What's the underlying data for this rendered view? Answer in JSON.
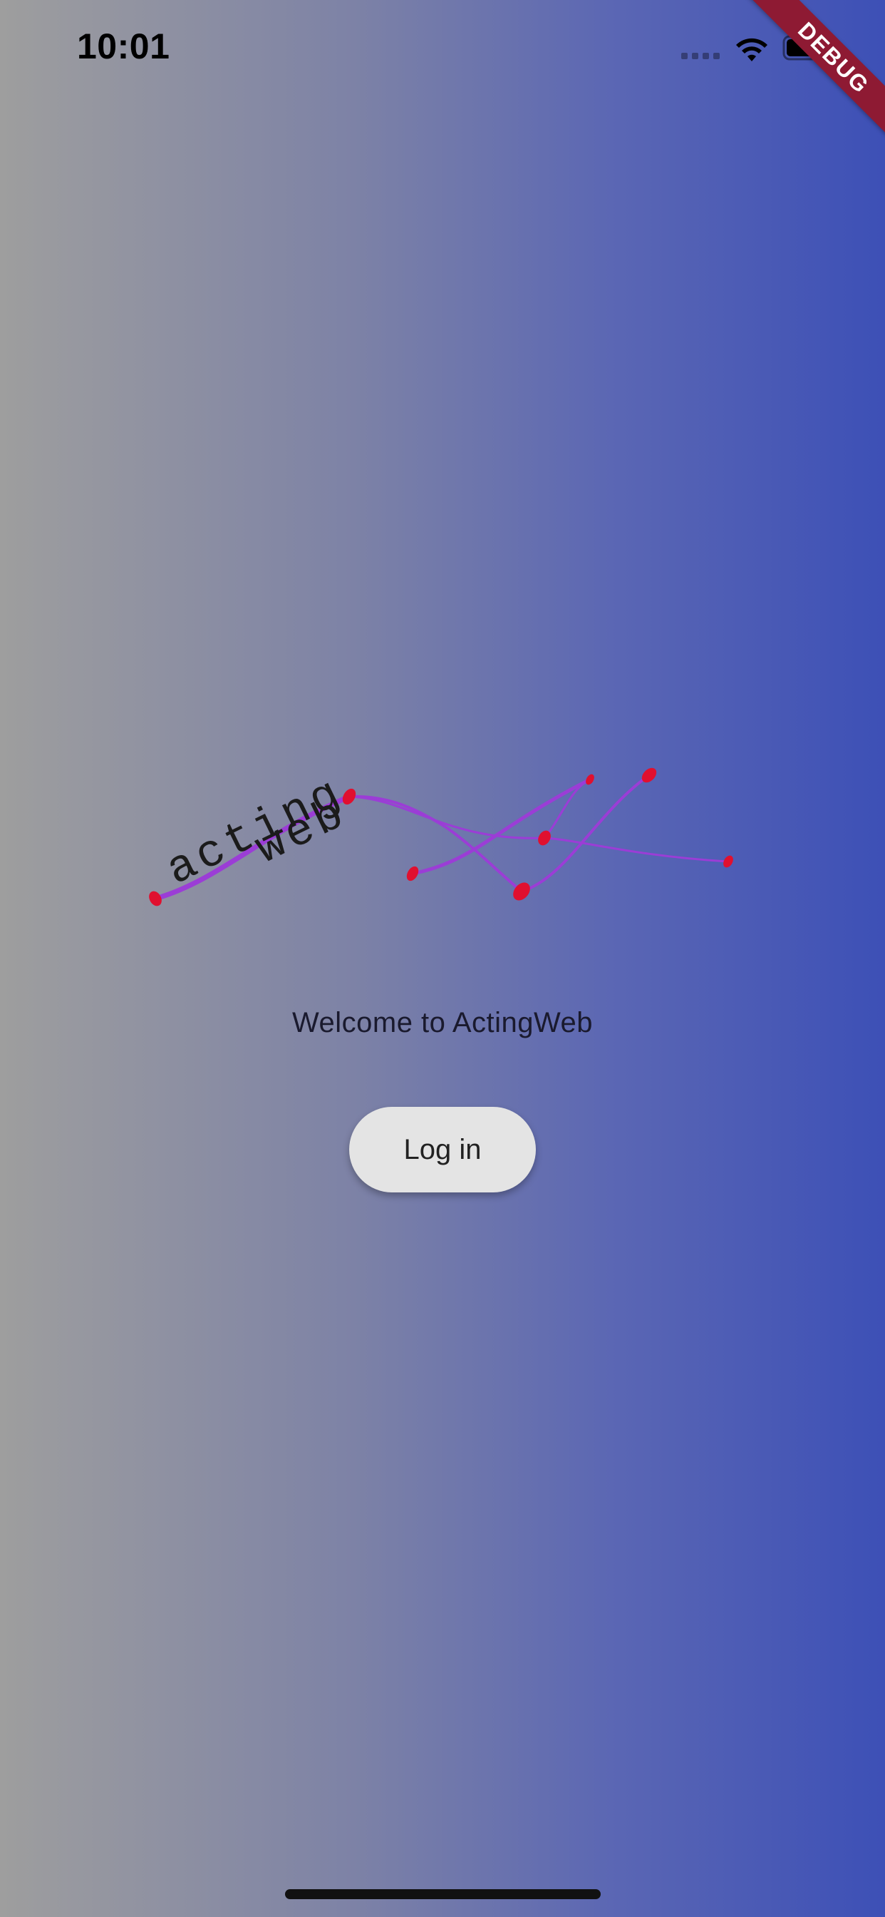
{
  "status_bar": {
    "time": "10:01",
    "icons": [
      "cellular-signal-icon",
      "wifi-icon",
      "battery-icon"
    ]
  },
  "debug_banner": {
    "label": "DEBUG",
    "color": "#8e1a33"
  },
  "logo": {
    "word_1": "acting",
    "word_2": "web",
    "line_color": "#9b3dd6",
    "node_color": "#e0102f"
  },
  "welcome": {
    "text": "Welcome to ActingWeb"
  },
  "login": {
    "label": "Log in"
  },
  "colors": {
    "gradient_left": "#9e9e9e",
    "gradient_right": "#3d50b6",
    "button_bg": "#e4e4e4"
  }
}
